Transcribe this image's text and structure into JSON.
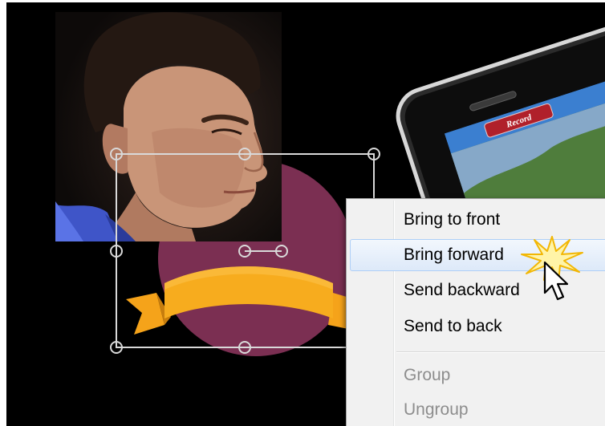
{
  "context_menu": {
    "items": [
      {
        "label": "Bring to front",
        "enabled": true
      },
      {
        "label": "Bring forward",
        "enabled": true,
        "highlighted": true
      },
      {
        "label": "Send backward",
        "enabled": true
      },
      {
        "label": "Send to back",
        "enabled": true
      },
      {
        "label": "Group",
        "enabled": false
      },
      {
        "label": "Ungroup",
        "enabled": false
      }
    ]
  },
  "phone": {
    "record_button_label": "Record"
  },
  "icons": {
    "cursor": "arrow-cursor-icon",
    "click_burst": "click-burst-icon"
  },
  "colors": {
    "canvas": "#000000",
    "circle_shape": "#7b2f52",
    "ribbon": "#f5a31a",
    "menu_background": "#f1f1f1",
    "menu_highlight": "#dde9f9",
    "menu_highlight_border": "#aecff7",
    "disabled_text": "#8d8d8d",
    "record_button": "#b0202a"
  }
}
